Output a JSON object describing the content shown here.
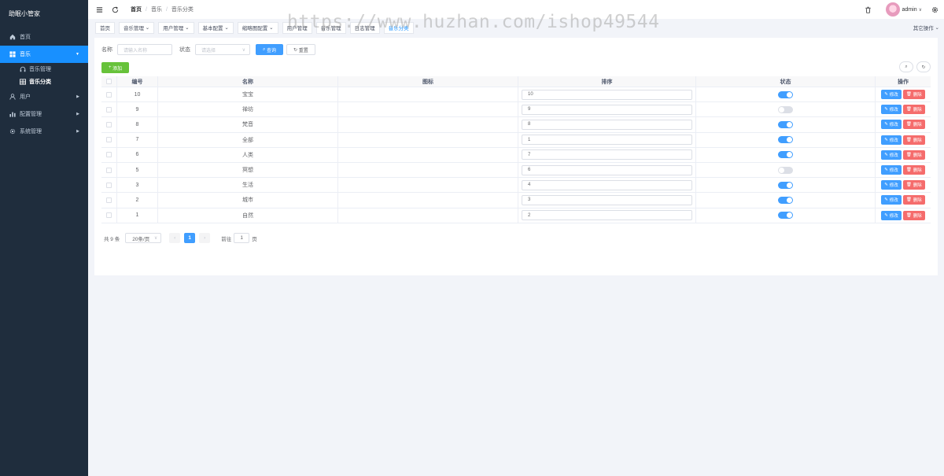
{
  "brand": "助眠小管家",
  "sidebar": {
    "items": [
      {
        "label": "首页",
        "icon": "home-icon"
      },
      {
        "label": "音乐",
        "icon": "grid-icon",
        "expanded": true,
        "children": [
          {
            "label": "音乐管理",
            "icon": "headphones-icon"
          },
          {
            "label": "音乐分类",
            "icon": "table-icon",
            "active": true
          }
        ]
      },
      {
        "label": "用户",
        "icon": "user-icon"
      },
      {
        "label": "配置管理",
        "icon": "chart-icon"
      },
      {
        "label": "系统管理",
        "icon": "gear-icon"
      }
    ]
  },
  "header": {
    "breadcrumb": [
      "首页",
      "音乐",
      "音乐分类"
    ],
    "user": "admin"
  },
  "tags": {
    "items": [
      "首页",
      "音乐管理",
      "用户管理",
      "基本配置",
      "缩略图配置",
      "用户管理",
      "音乐管理",
      "日志管理"
    ],
    "active_label": "音乐分类",
    "other_ops": "其它操作"
  },
  "search": {
    "name_label": "名称",
    "name_placeholder": "请输入名称",
    "status_label": "状态",
    "status_placeholder": "请选择",
    "query_button": "查询",
    "reset_button": "重置",
    "add_button": "添加"
  },
  "table": {
    "columns": [
      "编号",
      "名称",
      "图标",
      "排序",
      "状态",
      "操作"
    ],
    "edit_label": "修改",
    "delete_label": "删除",
    "rows": [
      {
        "id": "10",
        "name": "宝宝",
        "icon": "",
        "sort": "10",
        "status": true
      },
      {
        "id": "9",
        "name": "禅坊",
        "icon": "",
        "sort": "9",
        "status": false
      },
      {
        "id": "8",
        "name": "梵音",
        "icon": "",
        "sort": "8",
        "status": true
      },
      {
        "id": "7",
        "name": "全部",
        "icon": "",
        "sort": "1",
        "status": true
      },
      {
        "id": "6",
        "name": "人类",
        "icon": "",
        "sort": "7",
        "status": true
      },
      {
        "id": "5",
        "name": "冥想",
        "icon": "",
        "sort": "6",
        "status": false
      },
      {
        "id": "3",
        "name": "生活",
        "icon": "",
        "sort": "4",
        "status": true
      },
      {
        "id": "2",
        "name": "城市",
        "icon": "",
        "sort": "3",
        "status": true
      },
      {
        "id": "1",
        "name": "自然",
        "icon": "",
        "sort": "2",
        "status": true
      }
    ]
  },
  "pagination": {
    "total_text": "共 9 条",
    "page_size": "20条/页",
    "current_page": "1",
    "goto_label": "前往",
    "goto_value": "1",
    "page_unit": "页"
  },
  "watermark": "https://www.huzhan.com/ishop49544"
}
